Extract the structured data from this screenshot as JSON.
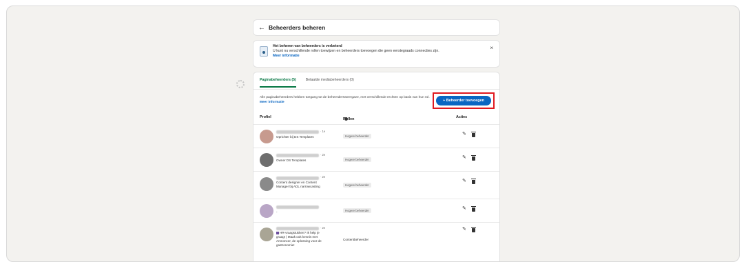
{
  "header": {
    "back_icon": "arrow-left-icon",
    "title": "Beheerders beheren"
  },
  "notice": {
    "icon": "admin-badge-icon",
    "title": "Het beheren van beheerders is verbeterd",
    "body": "U kunt nu verschillende rollen toewijzen en beheerders toevoegen die geen eerstegraads connecties zijn.",
    "link": "Meer informatie",
    "close": "×"
  },
  "tabs": [
    {
      "label": "Paginabeheerders (5)"
    },
    {
      "label": "Betaalde mediabeheerders (0)"
    }
  ],
  "description": {
    "text": "Alle paginabeheerders hebben toegang tot de beheerdersweergave, met verschillende rechten op basis van hun rol.",
    "link": "Meer informatie"
  },
  "add_button": "+ Beheerder toevoegen",
  "table": {
    "col_profile": "Profiel",
    "col_roles": "Rollen",
    "col_actions": "Acties",
    "rows": [
      {
        "degree": "· 1e",
        "headline": "Oprichter bij DS Templates",
        "role": "Hogere beheerder",
        "avatar_color": "#c79a8e"
      },
      {
        "degree": "· 2e",
        "headline": "Owner DS Templates",
        "role": "Hogere beheerder",
        "avatar_color": "#6e6e6e"
      },
      {
        "degree": "· 2e",
        "headline": "Content designer en Content Manager bij ADL narrowcasting",
        "role": "Hogere beheerder",
        "avatar_color": "#8a8a8a"
      },
      {
        "degree": "",
        "headline": "-",
        "role": "Hogere beheerder",
        "avatar_color": "#b9a6c6"
      },
      {
        "degree": "· 2e",
        "headline": "HR-vraagstukken? Ik help je graag! | Maak ook kennis met Amnoncer, de oplossing voor de gastronomie!",
        "role": "Contentbeheerder",
        "avatar_color": "#a9a595"
      }
    ]
  }
}
